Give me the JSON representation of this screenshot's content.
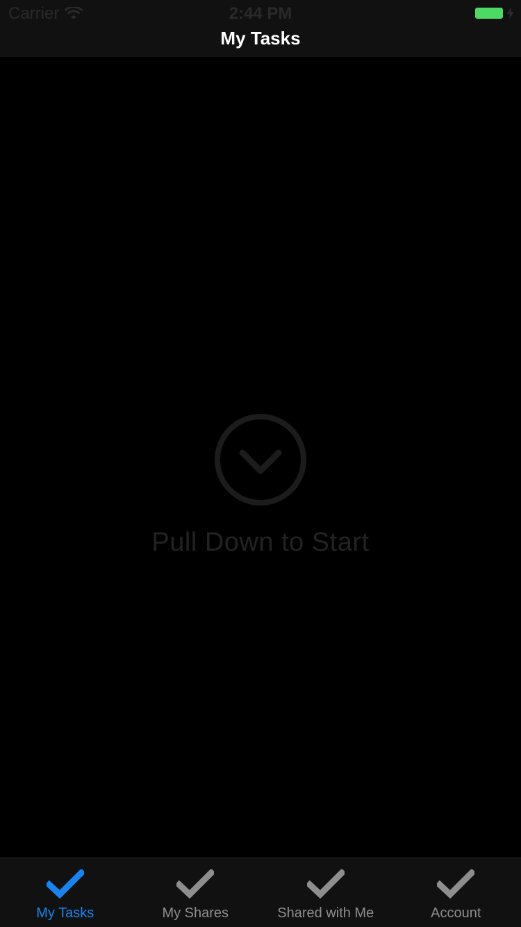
{
  "status_bar": {
    "carrier": "Carrier",
    "time": "2:44 PM",
    "battery_color": "#4cd964"
  },
  "nav": {
    "title": "My Tasks"
  },
  "empty_state": {
    "icon": "chevron-down-circle-icon",
    "message": "Pull Down to Start"
  },
  "tabs": [
    {
      "label": "My Tasks",
      "icon": "checkmark-icon",
      "active": true
    },
    {
      "label": "My Shares",
      "icon": "checkmark-icon",
      "active": false
    },
    {
      "label": "Shared with Me",
      "icon": "checkmark-icon",
      "active": false
    },
    {
      "label": "Account",
      "icon": "checkmark-icon",
      "active": false
    }
  ],
  "colors": {
    "accent": "#1a84ee",
    "inactive": "#8e8e8e",
    "background": "#000000"
  }
}
